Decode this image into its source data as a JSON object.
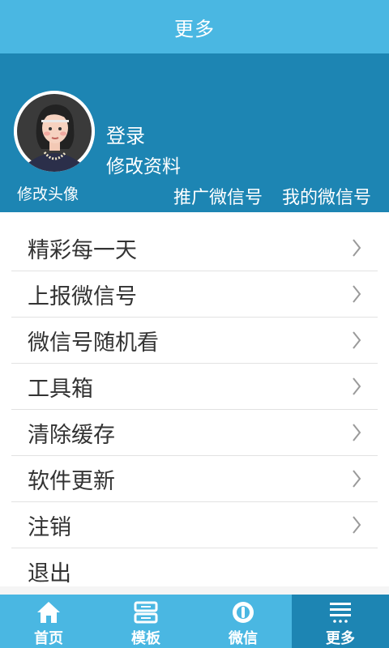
{
  "titlebar": {
    "title": "更多"
  },
  "profile": {
    "login": "登录",
    "edit_profile": "修改资料",
    "edit_avatar": "修改头像",
    "promote_wechat": "推广微信号",
    "my_wechat": "我的微信号"
  },
  "menu": [
    {
      "label": "精彩每一天",
      "chevron": true
    },
    {
      "label": "上报微信号",
      "chevron": true
    },
    {
      "label": "微信号随机看",
      "chevron": true
    },
    {
      "label": "工具箱",
      "chevron": true
    },
    {
      "label": "清除缓存",
      "chevron": true
    },
    {
      "label": "软件更新",
      "chevron": true
    },
    {
      "label": "注销",
      "chevron": true
    },
    {
      "label": "退出",
      "chevron": false
    }
  ],
  "tabs": [
    {
      "label": "首页",
      "icon": "home-icon"
    },
    {
      "label": "模板",
      "icon": "template-icon"
    },
    {
      "label": "微信",
      "icon": "wechat-icon"
    },
    {
      "label": "更多",
      "icon": "more-icon",
      "active": true
    }
  ],
  "colors": {
    "titlebar": "#4ab7e2",
    "profile_bg": "#1d85b3",
    "tab_active": "#1d85b3"
  }
}
